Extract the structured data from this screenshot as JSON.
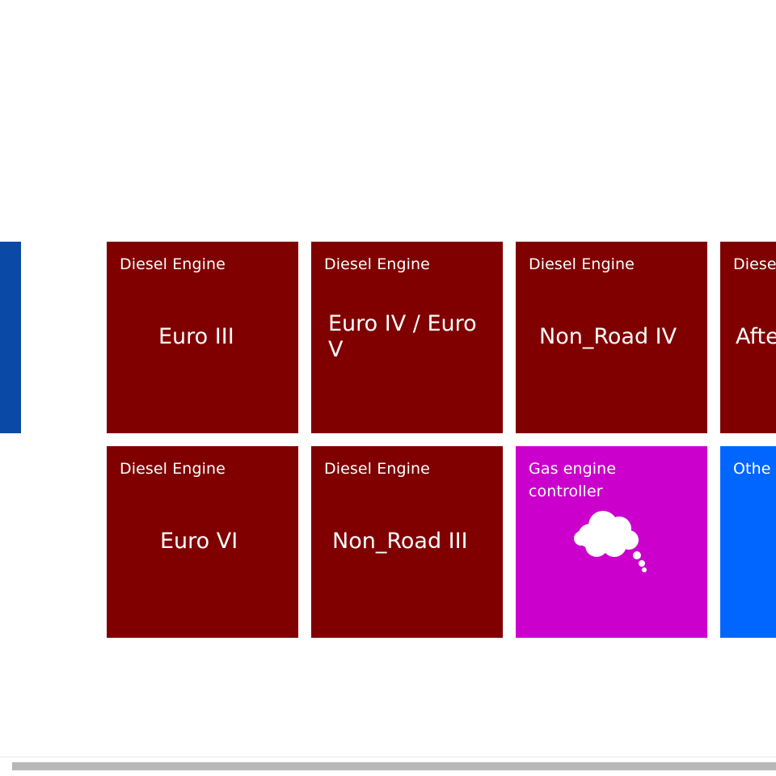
{
  "tiles": [
    {
      "category": "Diesel Engine",
      "title": "Euro III",
      "color": "#800000"
    },
    {
      "category": "Diesel Engine",
      "title": "Euro IV / Euro\nV",
      "color": "#800000"
    },
    {
      "category": "Diesel Engine",
      "title": "Non_Road IV",
      "color": "#800000"
    },
    {
      "category": "Diese",
      "title": "Afte",
      "color": "#800000"
    },
    {
      "category": "Diesel Engine",
      "title": "Euro VI",
      "color": "#800000"
    },
    {
      "category": "Diesel Engine",
      "title": "Non_Road III",
      "color": "#800000"
    },
    {
      "category": "Gas engine\ncontroller",
      "title": "",
      "icon": "cloud-icon",
      "color": "#cc00cc"
    },
    {
      "category": "Othe",
      "title": "",
      "color": "#0066ff"
    }
  ],
  "colors": {
    "side_strip": "#0a4aa6",
    "background": "#ffffff"
  }
}
